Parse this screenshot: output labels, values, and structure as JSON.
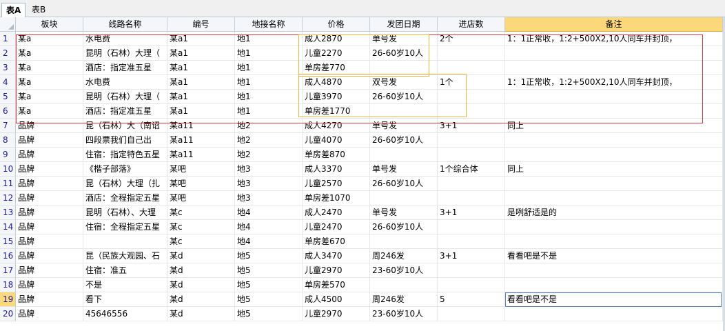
{
  "tabs": [
    {
      "label": "表A",
      "active": true
    },
    {
      "label": "表B",
      "active": false
    }
  ],
  "headers": [
    "板块",
    "线路名称",
    "编号",
    "地接名称",
    "价格",
    "发团日期",
    "进店数",
    "备注"
  ],
  "rows": [
    [
      "某a",
      "水电费",
      "某a1",
      "地1",
      "成人2870",
      "单号发",
      "2个",
      "1：1正常收，1:2+500X2,10人同车并封顶，"
    ],
    [
      "某a",
      "昆明（石林）大理（",
      "某a1",
      "地1",
      "儿童2270",
      "26-60岁10人",
      "",
      ""
    ],
    [
      "某a",
      "酒店：指定准五星",
      "某a1",
      "地1",
      "单房差770",
      "",
      "",
      ""
    ],
    [
      "某a",
      "水电费",
      "某a1",
      "地1",
      "成人4870",
      "双号发",
      "1个",
      "1：1正常收，1:2+500X2,10人同车并封顶，"
    ],
    [
      "某a",
      "昆明（石林）大理（",
      "某a1",
      "地1",
      "儿童3970",
      "26-60岁10人",
      "",
      ""
    ],
    [
      "某a",
      "酒店：指定准五星",
      "某a1",
      "地1",
      "单房差1770",
      "",
      "",
      ""
    ],
    [
      "品牌",
      "昆（石林）大（南诏",
      "某a11",
      "地2",
      "成人4270",
      "单号发",
      "3+1",
      "同上"
    ],
    [
      "品牌",
      "四段票我们自己出",
      "某a11",
      "地2",
      "儿童4070",
      "26-60岁10人",
      "",
      ""
    ],
    [
      "品牌",
      "住宿：指定特色五星",
      "某a11",
      "地2",
      "单房差870",
      "",
      "",
      ""
    ],
    [
      "品牌",
      "《楷子部落》",
      "某吧",
      "地3",
      "成人3370",
      "单号发",
      "1个综合体",
      "同上"
    ],
    [
      "品牌",
      "昆（石林）大理（扎",
      "某吧",
      "地3",
      "儿童2570",
      "26-60岁10人",
      "",
      ""
    ],
    [
      "品牌",
      "酒店：全程指定五星",
      "某吧",
      "地3",
      "单房差1070",
      "",
      "",
      ""
    ],
    [
      "品牌",
      "昆明（石林）、大理",
      "某c",
      "地4",
      "成人2470",
      "单号发",
      "3+1",
      "是咧舒适是的"
    ],
    [
      "品牌",
      "住宿：全程指定五星",
      "某c",
      "地4",
      "儿童2470",
      "26-60岁10人",
      "",
      ""
    ],
    [
      "品牌",
      "",
      "某c",
      "地4",
      "单房差670",
      "",
      "",
      ""
    ],
    [
      "品牌",
      "昆（民族大观园、石",
      "某d",
      "地5",
      "成人3470",
      "周246发",
      "3+1",
      "看看吧是不是"
    ],
    [
      "品牌",
      "住宿：准五",
      "某d",
      "地5",
      "儿童2970",
      "23-60岁10人",
      "",
      ""
    ],
    [
      "品牌",
      "不是",
      "某d",
      "地5",
      "单房差570",
      "",
      "",
      ""
    ],
    [
      "品牌",
      "看下",
      "某d",
      "地5",
      "成人4500",
      "周246发",
      "5",
      "看看吧是不是"
    ],
    [
      "品牌",
      "45646556",
      "某d",
      "地5",
      "儿童2970",
      "23-60岁10人",
      "",
      ""
    ]
  ],
  "selected_row": 19,
  "selected_col": 7,
  "colors": {
    "selection_header": "#fcd87a",
    "red_box": "#d9363e",
    "orange_box": "#f0b43c"
  }
}
